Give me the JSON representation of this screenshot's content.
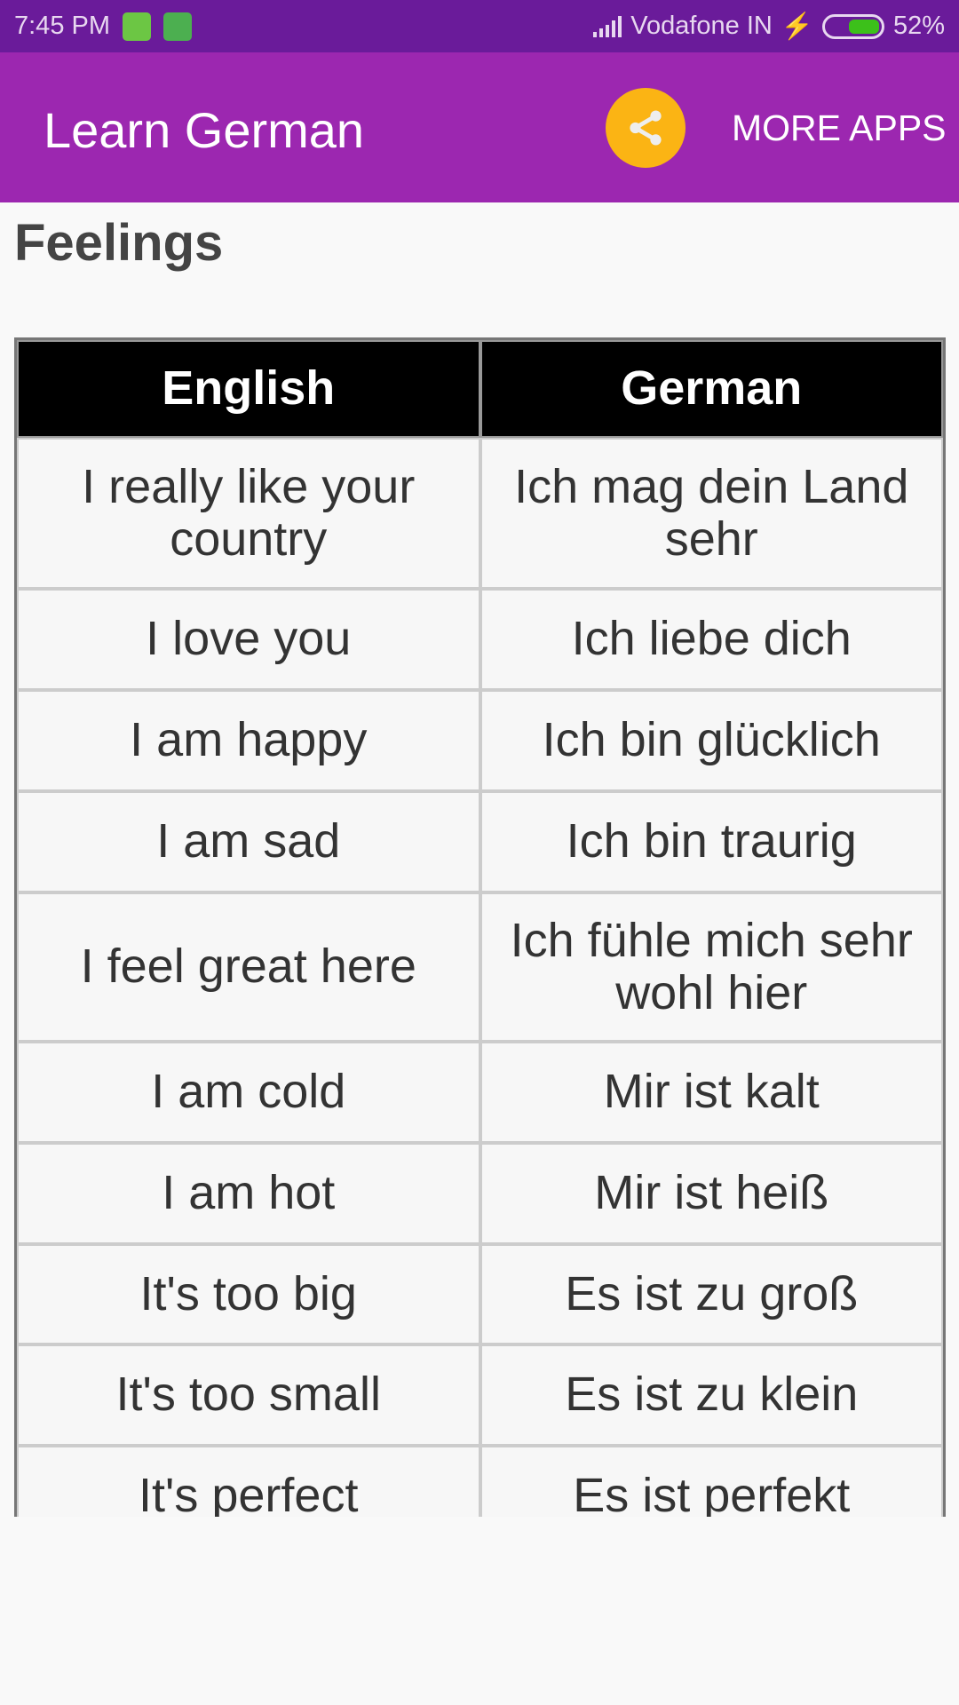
{
  "status": {
    "time": "7:45 PM",
    "carrier": "Vodafone IN",
    "battery": "52%",
    "battery_level": 0.52
  },
  "appbar": {
    "title": "Learn German",
    "share_icon": "share-icon",
    "more_apps": "MORE APPS",
    "color": "#9c27b0"
  },
  "section_title": "Feelings",
  "table": {
    "headers": [
      "English",
      "German"
    ],
    "rows": [
      [
        "I really like your country",
        "Ich mag dein Land sehr"
      ],
      [
        "I love you",
        "Ich liebe dich"
      ],
      [
        "I am happy",
        "Ich bin glücklich"
      ],
      [
        "I am sad",
        "Ich bin traurig"
      ],
      [
        "I feel great here",
        "Ich fühle mich sehr wohl hier"
      ],
      [
        "I am cold",
        "Mir ist kalt"
      ],
      [
        "I am hot",
        "Mir ist heiß"
      ],
      [
        "It's too big",
        "Es ist zu groß"
      ],
      [
        "It's too small",
        "Es ist zu klein"
      ],
      [
        "It's perfect",
        "Es ist perfekt"
      ]
    ]
  }
}
